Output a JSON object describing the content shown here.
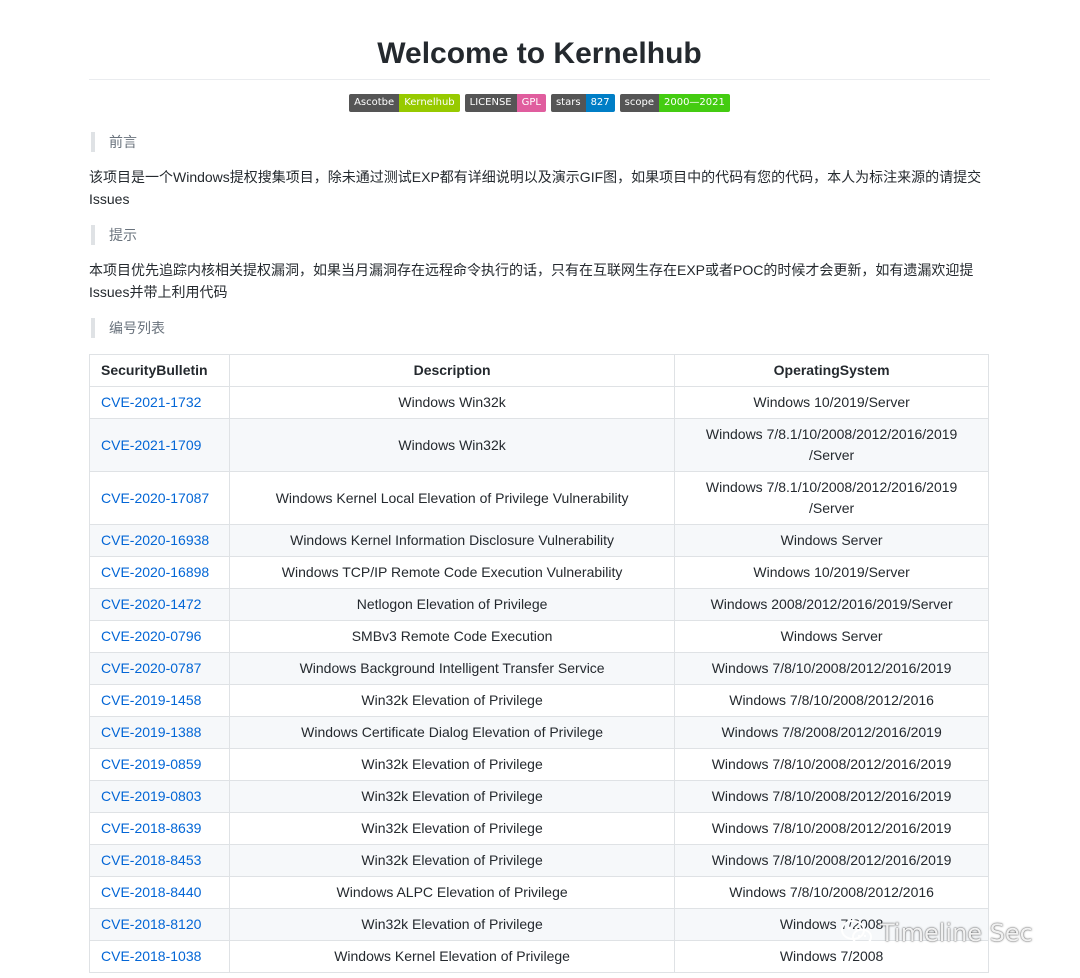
{
  "header": {
    "title": "Welcome to Kernelhub"
  },
  "badges": [
    {
      "label": "Ascotbe",
      "value": "Kernelhub",
      "color": "#97ca00"
    },
    {
      "label": "LICENSE",
      "value": "GPL",
      "color": "#e05d9e"
    },
    {
      "label": "stars",
      "value": "827",
      "color": "#007ec6"
    },
    {
      "label": "scope",
      "value": "2000—2021",
      "color": "#44cc11"
    }
  ],
  "sections": {
    "preface_heading": "前言",
    "preface_text": "该项目是一个Windows提权搜集项目，除未通过测试EXP都有详细说明以及演示GIF图，如果项目中的代码有您的代码，本人为标注来源的请提交Issues",
    "tip_heading": "提示",
    "tip_text": "本项目优先追踪内核相关提权漏洞，如果当月漏洞存在远程命令执行的话，只有在互联网生存在EXP或者POC的时候才会更新，如有遗漏欢迎提Issues并带上利用代码",
    "list_heading": "编号列表"
  },
  "table": {
    "headers": [
      "SecurityBulletin",
      "Description",
      "OperatingSystem"
    ],
    "rows": [
      {
        "cve": "CVE-2021-1732",
        "desc": "Windows Win32k",
        "os": "Windows 10/2019/Server"
      },
      {
        "cve": "CVE-2021-1709",
        "desc": "Windows Win32k",
        "os": "Windows 7/8.1/10/2008/2012/2016/2019 /Server"
      },
      {
        "cve": "CVE-2020-17087",
        "desc": "Windows Kernel Local Elevation of Privilege Vulnerability",
        "os": "Windows 7/8.1/10/2008/2012/2016/2019 /Server"
      },
      {
        "cve": "CVE-2020-16938",
        "desc": "Windows Kernel Information Disclosure Vulnerability",
        "os": "Windows Server"
      },
      {
        "cve": "CVE-2020-16898",
        "desc": "Windows TCP/IP Remote Code Execution Vulnerability",
        "os": "Windows 10/2019/Server"
      },
      {
        "cve": "CVE-2020-1472",
        "desc": "Netlogon Elevation of Privilege",
        "os": "Windows 2008/2012/2016/2019/Server"
      },
      {
        "cve": "CVE-2020-0796",
        "desc": "SMBv3 Remote Code Execution",
        "os": "Windows Server"
      },
      {
        "cve": "CVE-2020-0787",
        "desc": "Windows Background Intelligent Transfer Service",
        "os": "Windows 7/8/10/2008/2012/2016/2019"
      },
      {
        "cve": "CVE-2019-1458",
        "desc": "Win32k Elevation of Privilege",
        "os": "Windows 7/8/10/2008/2012/2016"
      },
      {
        "cve": "CVE-2019-1388",
        "desc": "Windows Certificate Dialog Elevation of Privilege",
        "os": "Windows 7/8/2008/2012/2016/2019"
      },
      {
        "cve": "CVE-2019-0859",
        "desc": "Win32k Elevation of Privilege",
        "os": "Windows 7/8/10/2008/2012/2016/2019"
      },
      {
        "cve": "CVE-2019-0803",
        "desc": "Win32k Elevation of Privilege",
        "os": "Windows 7/8/10/2008/2012/2016/2019"
      },
      {
        "cve": "CVE-2018-8639",
        "desc": "Win32k Elevation of Privilege",
        "os": "Windows 7/8/10/2008/2012/2016/2019"
      },
      {
        "cve": "CVE-2018-8453",
        "desc": "Win32k Elevation of Privilege",
        "os": "Windows 7/8/10/2008/2012/2016/2019"
      },
      {
        "cve": "CVE-2018-8440",
        "desc": "Windows ALPC Elevation of Privilege",
        "os": "Windows 7/8/10/2008/2012/2016"
      },
      {
        "cve": "CVE-2018-8120",
        "desc": "Win32k Elevation of Privilege",
        "os": "Windows 7/2008"
      },
      {
        "cve": "CVE-2018-1038",
        "desc": "Windows Kernel Elevation of Privilege",
        "os": "Windows 7/2008"
      }
    ]
  },
  "watermark": {
    "text": "Timeline Sec",
    "icon": "wechat-icon"
  }
}
